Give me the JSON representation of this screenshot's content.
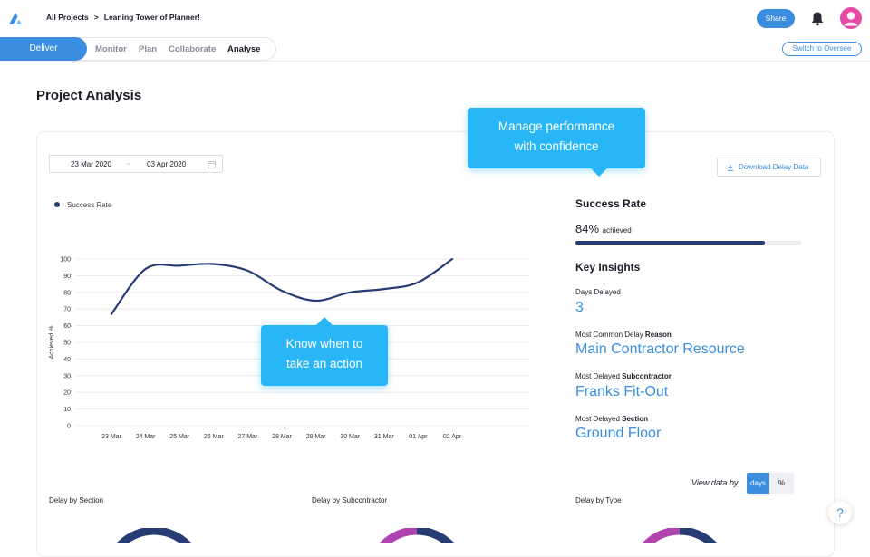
{
  "header": {
    "breadcrumb_root": "All Projects",
    "breadcrumb_sep": ">",
    "breadcrumb_current": "Leaning Tower of Planner!",
    "share_label": "Share"
  },
  "nav": {
    "tabs": [
      {
        "label": "Deliver"
      },
      {
        "label": "Monitor"
      },
      {
        "label": "Plan"
      },
      {
        "label": "Collaborate"
      },
      {
        "label": "Analyse"
      }
    ],
    "active_tab": "Analyse",
    "switch_label": "Switch to Oversee"
  },
  "page": {
    "title": "Project Analysis"
  },
  "filters": {
    "date_from": "23 Mar 2020",
    "date_sep": "~",
    "date_to": "03 Apr 2020",
    "download_label": "Download Delay Data"
  },
  "tooltips": {
    "top_line1": "Manage performance",
    "top_line2": "with confidence",
    "chart_line1": "Know when to",
    "chart_line2": "take an action"
  },
  "chart_data": {
    "type": "line",
    "legend": "Success Rate",
    "ylabel": "Achieved %",
    "xlabel": "",
    "x": [
      "23 Mar",
      "24 Mar",
      "25 Mar",
      "26 Mar",
      "27 Mar",
      "28 Mar",
      "29 Mar",
      "30 Mar",
      "31 Mar",
      "01 Apr",
      "02 Apr"
    ],
    "y_ticks": [
      0,
      10,
      20,
      30,
      40,
      50,
      60,
      70,
      80,
      90,
      100
    ],
    "ylim": [
      0,
      100
    ],
    "series": [
      {
        "name": "Success Rate",
        "values": [
          67,
          94,
          96,
          97,
          93,
          81,
          75,
          80,
          82,
          86,
          100
        ]
      }
    ],
    "grid": true,
    "line_color": "#273c75"
  },
  "summary": {
    "success_title": "Success Rate",
    "success_pct": "84%",
    "success_suffix": "achieved",
    "success_fraction": 0.84,
    "insights_title": "Key Insights",
    "days_delayed_label": "Days Delayed",
    "days_delayed_value": "3",
    "reason_label_a": "Most Common Delay ",
    "reason_label_b": "Reason",
    "reason_value": "Main Contractor Resource",
    "sub_label_a": "Most Delayed ",
    "sub_label_b": "Subcontractor",
    "sub_value": "Franks Fit-Out",
    "section_label_a": "Most Delayed ",
    "section_label_b": "Section",
    "section_value": "Ground Floor"
  },
  "viewdata": {
    "label": "View data by",
    "days": "days",
    "percent": "%"
  },
  "breakdowns": {
    "section": "Delay by Section",
    "subcontractor": "Delay by Subcontractor",
    "type": "Delay by Type"
  },
  "help": {
    "symbol": "?"
  },
  "colors": {
    "primary": "#3b8de0",
    "navy": "#273c75",
    "tooltip": "#29b6f6",
    "magenta": "#b043b0",
    "avatar": "#e64ba3"
  }
}
